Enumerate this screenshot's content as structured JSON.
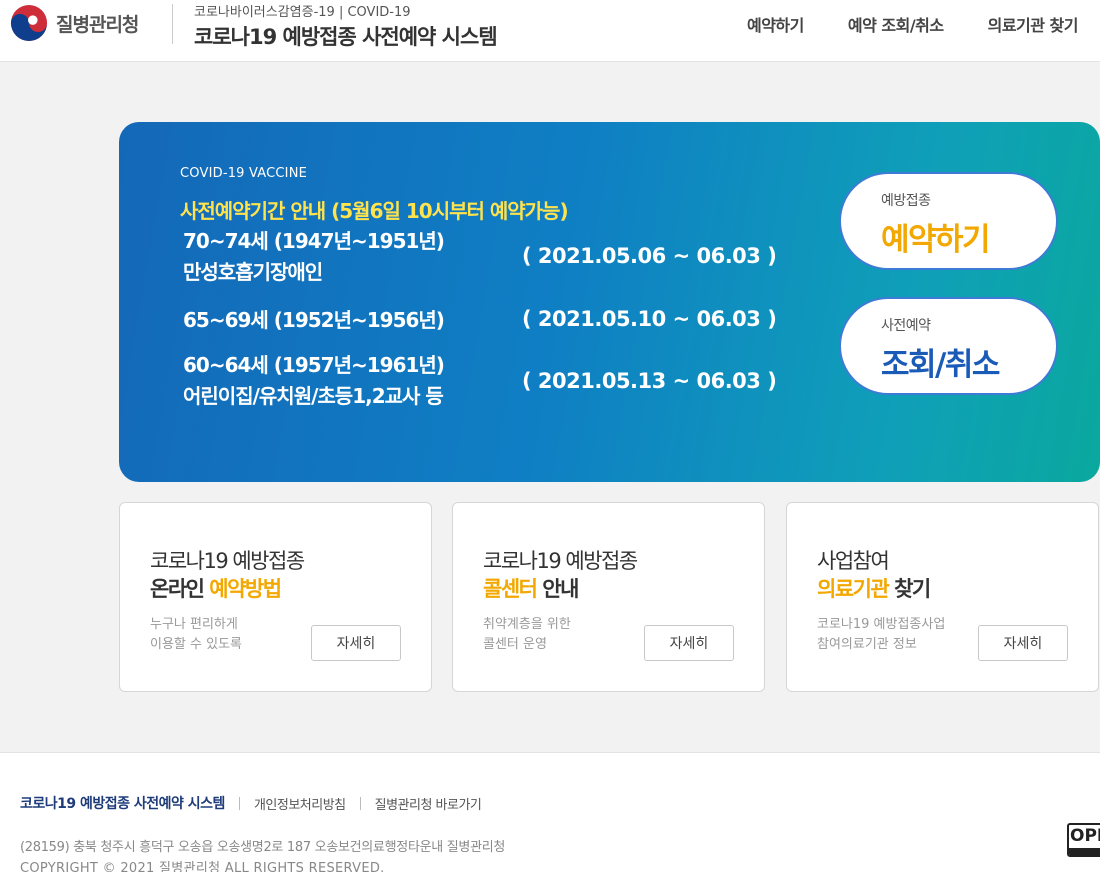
{
  "header": {
    "logo_text": "질병관리청",
    "subtitle": "코로나바이러스감염증-19 | COVID-19",
    "title": "코로나19 예방접종 사전예약 시스템",
    "nav": [
      "예약하기",
      "예약 조회/취소",
      "의료기관 찾기"
    ]
  },
  "banner": {
    "eyebrow": "COVID-19 VACCINE",
    "notice": "사전예약기간 안내 (5월6일 10시부터 예약가능)",
    "groups": [
      {
        "line1": "70~74세 (1947년~1951년)",
        "line2": "만성호흡기장애인",
        "period": "( 2021.05.06 ~ 06.03 )"
      },
      {
        "line1": "65~69세 (1952년~1956년)",
        "period": "( 2021.05.10 ~ 06.03 )"
      },
      {
        "line1": "60~64세 (1957년~1961년)",
        "line2": "어린이집/유치원/초등1,2교사 등",
        "period": "( 2021.05.13 ~ 06.03 )"
      }
    ],
    "reserve_button": {
      "small": "예방접종",
      "big": "예약하기"
    },
    "lookup_button": {
      "small": "사전예약",
      "big": "조회/취소"
    }
  },
  "cards": [
    {
      "line1": "코로나19 예방접종",
      "line2_plain": "온라인 ",
      "line2_hl": "예약방법",
      "desc1": "누구나 편리하게",
      "desc2": "이용할 수 있도록",
      "button": "자세히"
    },
    {
      "line1": "코로나19 예방접종",
      "line2_hl": "콜센터",
      "line2_plain": " 안내",
      "desc1": "취약계층을 위한",
      "desc2": "콜센터 운영",
      "button": "자세히"
    },
    {
      "line1": "사업참여",
      "line2_hl": "의료기관",
      "line2_plain": " 찾기",
      "desc1": "코로나19 예방접종사업",
      "desc2": "참여의료기관 정보",
      "button": "자세히"
    }
  ],
  "footer": {
    "title": "코로나19 예방접종 사전예약 시스템",
    "links": [
      "개인정보처리방침",
      "질병관리청 바로가기"
    ],
    "address": "(28159) 충북 청주시 흥덕구 오송읍 오송생명2로 187 오송보건의료행정타운내 질병관리청",
    "copyright": "COPYRIGHT © 2021 질병관리청 ALL RIGHTS RESERVED.",
    "badge": "OPM"
  },
  "colors": {
    "accent_yellow": "#f2a800",
    "notice_yellow": "#ffe34d",
    "lookup_blue": "#1a5bb8",
    "banner_blue": "#1468b8",
    "banner_teal": "#0aa89e"
  }
}
